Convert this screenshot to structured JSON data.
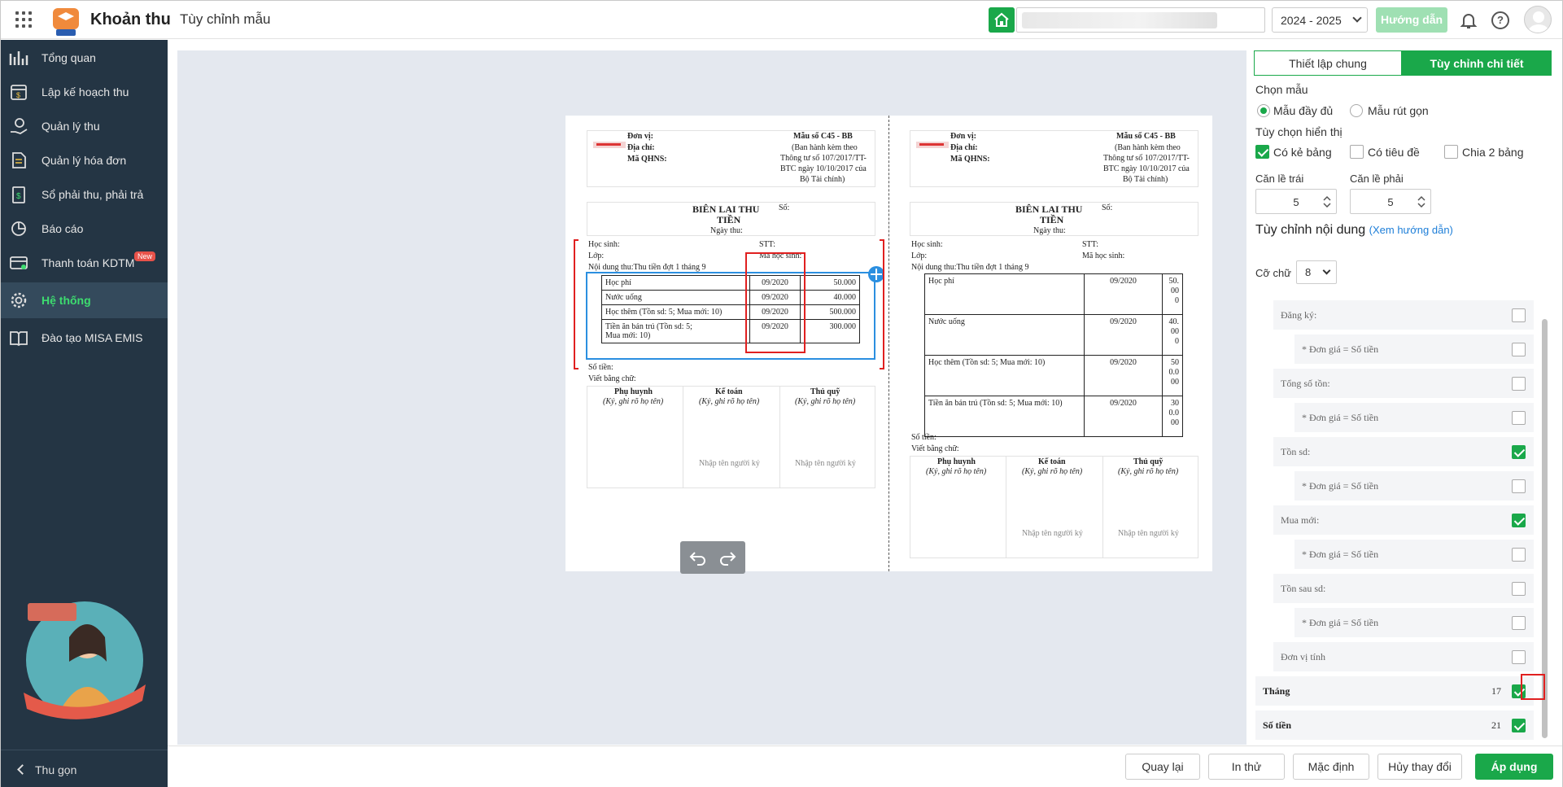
{
  "header": {
    "app_title": "Khoản thu",
    "page_title": "Tùy chỉnh mẫu",
    "school_year": "2024 - 2025",
    "guide_label": "Hướng dẫn",
    "help_label": "?"
  },
  "sidebar": {
    "items": [
      {
        "label": "Tổng quan"
      },
      {
        "label": "Lập kế hoạch thu"
      },
      {
        "label": "Quản lý thu"
      },
      {
        "label": "Quản lý hóa đơn"
      },
      {
        "label": "Sổ phải thu, phải trả"
      },
      {
        "label": "Báo cáo"
      },
      {
        "label": "Thanh toán KDTM",
        "badge": "New"
      },
      {
        "label": "Hệ thống"
      },
      {
        "label": "Đào tạo MISA EMIS"
      }
    ],
    "collapse_label": "Thu gọn"
  },
  "receipt_left": {
    "don_vi": "Đơn vị:",
    "dia_chi": "Địa chỉ:",
    "ma_qhns": "Mã QHNS:",
    "mau_so": "Mẫu số C45 - BB",
    "ban_hanh": "(Ban hành kèm theo",
    "thong_tu": "Thông tư số 107/2017/TT-",
    "btc": "BTC ngày 10/10/2017 của",
    "bo": "Bộ Tài chính)",
    "title1": "BIÊN LAI THU",
    "title2": "TIỀN",
    "ngay_thu": "Ngày thu:",
    "so": "Số:",
    "hoc_sinh": "Học sinh:",
    "stt": "STT:",
    "lop": "Lớp:",
    "ma_hs": "Mã học sinh:",
    "noi_dung": "Nội dung thu:Thu tiền đợt 1 tháng 9",
    "rows": [
      {
        "name": "Học phí",
        "month": "09/2020",
        "amount": "50.000"
      },
      {
        "name": "Nước uống",
        "month": "09/2020",
        "amount": "40.000"
      },
      {
        "name": "Học thêm (Tồn sd: 5; Mua mới: 10)",
        "month": "09/2020",
        "amount": "500.000"
      },
      {
        "name": "Tiền ăn bán trú (Tồn sd: 5;",
        "name2": "Mua mới: 10)",
        "month": "09/2020",
        "amount": "300.000"
      }
    ],
    "so_tien": "Số tiền:",
    "viet_bang_chu": "Viết bằng chữ:",
    "sig": [
      {
        "title": "Phụ huynh",
        "sub": "(Ký, ghi rõ họ tên)",
        "ph": ""
      },
      {
        "title": "Kế toán",
        "sub": "(Ký, ghi rõ họ tên)",
        "ph": "Nhập tên người ký"
      },
      {
        "title": "Thủ quỹ",
        "sub": "(Ký, ghi rõ họ tên)",
        "ph": "Nhập tên người ký"
      }
    ]
  },
  "receipt_right": {
    "rows": [
      {
        "name": "Học phí",
        "month": "09/2020",
        "amount": [
          "50.",
          "00",
          "0"
        ]
      },
      {
        "name": "Nước uống",
        "month": "09/2020",
        "amount": [
          "40.",
          "00",
          "0"
        ]
      },
      {
        "name": "Học thêm (Tồn sd: 5; Mua mới: 10)",
        "month": "09/2020",
        "amount": [
          "50",
          "0.0",
          "00"
        ]
      },
      {
        "name": "Tiền ăn bán trú (Tồn sd: 5; Mua mới: 10)",
        "month": "09/2020",
        "amount": [
          "30",
          "0.0",
          "00"
        ]
      }
    ]
  },
  "panel": {
    "tab_general": "Thiết lập chung",
    "tab_detail": "Tùy chỉnh chi tiết",
    "choose_template": "Chọn mẫu",
    "full_template": "Mẫu đầy đủ",
    "short_template": "Mẫu rút gọn",
    "display_options": "Tùy chọn hiển thị",
    "opt_border": "Có kẻ bảng",
    "opt_heading": "Có tiêu đề",
    "opt_split": "Chia 2 bảng",
    "margin_left_label": "Căn lề trái",
    "margin_left": "5",
    "margin_right_label": "Căn lề phải",
    "margin_right": "5",
    "content_title": "Tùy chỉnh nội dung",
    "guide_link": "(Xem hướng dẫn)",
    "font_size_label": "Cỡ chữ",
    "font_size": "8",
    "fields": [
      {
        "label": "Đăng ký:",
        "checked": false,
        "indent": 1
      },
      {
        "label": "* Đơn giá = Số tiền",
        "checked": false,
        "indent": 2
      },
      {
        "label": "Tổng số tồn:",
        "checked": false,
        "indent": 1
      },
      {
        "label": "* Đơn giá = Số tiền",
        "checked": false,
        "indent": 2
      },
      {
        "label": "Tồn sd:",
        "checked": true,
        "indent": 1
      },
      {
        "label": "* Đơn giá = Số tiền",
        "checked": false,
        "indent": 2
      },
      {
        "label": "Mua mới:",
        "checked": true,
        "indent": 1
      },
      {
        "label": "* Đơn giá = Số tiền",
        "checked": false,
        "indent": 2
      },
      {
        "label": "Tồn sau sd:",
        "checked": false,
        "indent": 1
      },
      {
        "label": "* Đơn giá = Số tiền",
        "checked": false,
        "indent": 2
      },
      {
        "label": "Đơn vị tính",
        "checked": false,
        "indent": 1
      },
      {
        "label": "Tháng",
        "checked": true,
        "indent": 0,
        "width": "17"
      },
      {
        "label": "Số tiền",
        "checked": true,
        "indent": 0,
        "width": "21"
      }
    ]
  },
  "footer": {
    "back": "Quay lại",
    "print": "In thử",
    "default": "Mặc định",
    "cancel": "Hủy thay đổi",
    "apply": "Áp dụng"
  },
  "colors": {
    "accent": "#1aa84a",
    "sidebar": "#243544",
    "highlight": "#e02020"
  }
}
